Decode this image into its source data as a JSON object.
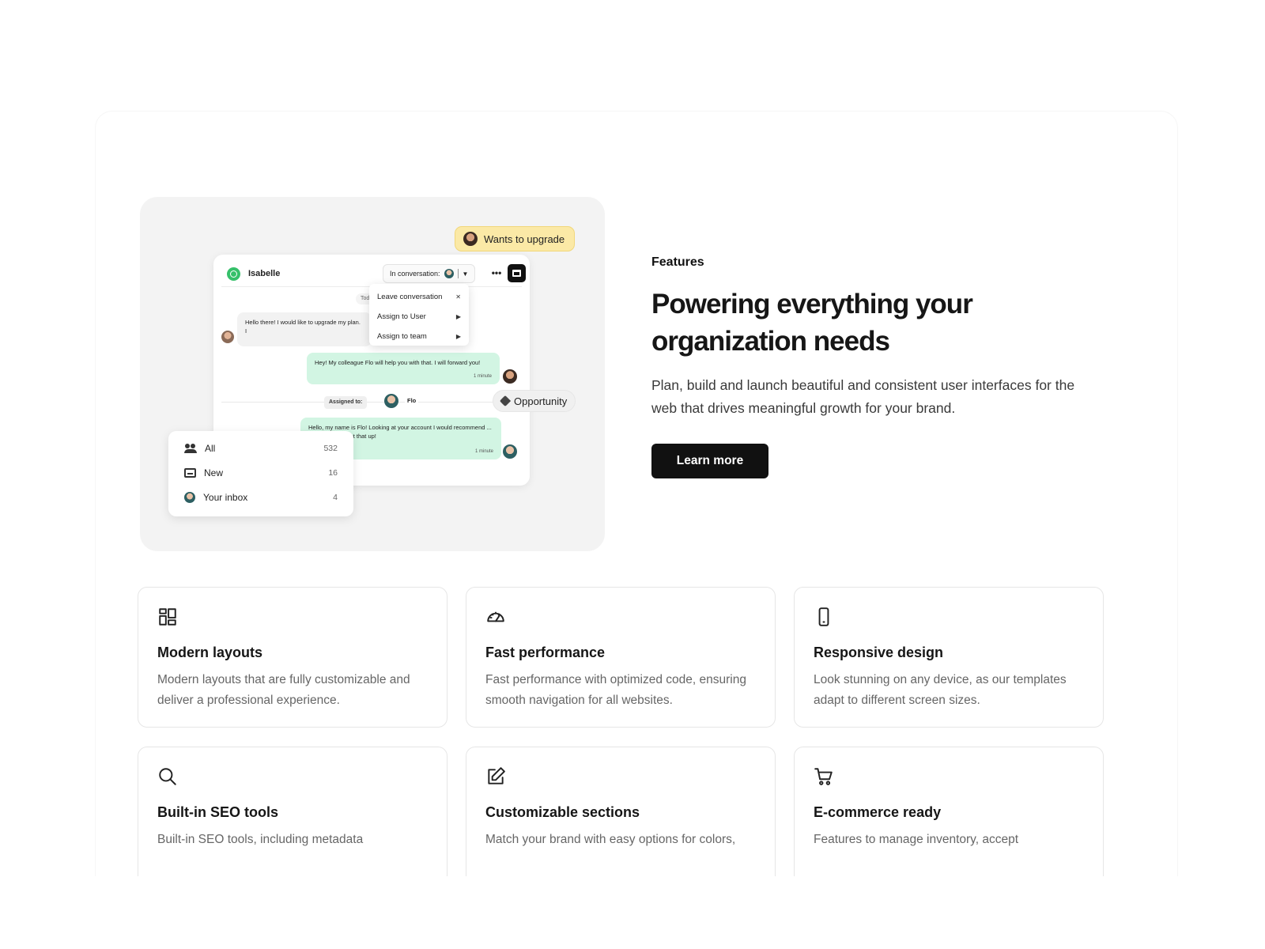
{
  "hero_image": {
    "upgrade_pill": "Wants to upgrade",
    "chat": {
      "contact_name": "Isabelle",
      "status_label": "In conversation:",
      "more_label": "•••",
      "today_chip": "Today",
      "menu": [
        {
          "label": "Leave conversation"
        },
        {
          "label": "Assign to User"
        },
        {
          "label": "Assign to team"
        }
      ],
      "message_in": "Hello there! I would like to upgrade my plan. I",
      "message_out_1": "Hey! My colleague Flo will help you with that. I will forward you!",
      "message_out_1_time": "1 minute",
      "assigned_label": "Assigned to:",
      "assigned_name": "Flo",
      "message_out_2": "Hello, my name is Flo! Looking at your account I would recommend ... I can help you set that up!",
      "message_out_2_time": "1 minute"
    },
    "opportunity_tag": "Opportunity",
    "inbox": [
      {
        "label": "All",
        "count": "532"
      },
      {
        "label": "New",
        "count": "16"
      },
      {
        "label": "Your inbox",
        "count": "4"
      }
    ]
  },
  "hero": {
    "eyebrow": "Features",
    "headline": "Powering everything your organization needs",
    "lede": "Plan, build and launch beautiful and consistent user interfaces for the web that drives meaningful growth for your brand.",
    "cta_label": "Learn more"
  },
  "features": [
    {
      "icon": "layout-grid-icon",
      "title": "Modern layouts",
      "desc": "Modern layouts that are fully customizable and deliver a professional experience."
    },
    {
      "icon": "speedometer-icon",
      "title": "Fast performance",
      "desc": "Fast performance with optimized code, ensuring smooth navigation for all websites."
    },
    {
      "icon": "mobile-phone-icon",
      "title": "Responsive design",
      "desc": "Look stunning on any device, as our templates adapt to different screen sizes."
    },
    {
      "icon": "search-icon",
      "title": "Built-in SEO tools",
      "desc": "Built-in SEO tools, including metadata"
    },
    {
      "icon": "edit-icon",
      "title": "Customizable sections",
      "desc": "Match your brand with easy options for colors,"
    },
    {
      "icon": "shopping-cart-icon",
      "title": "E-commerce ready",
      "desc": "Features to manage inventory, accept"
    }
  ],
  "colors": {
    "accent": "#111111",
    "upgrade_pill": "#fbe9a6",
    "bubble_green": "#d2f5e3",
    "whatsapp": "#36c06a"
  }
}
